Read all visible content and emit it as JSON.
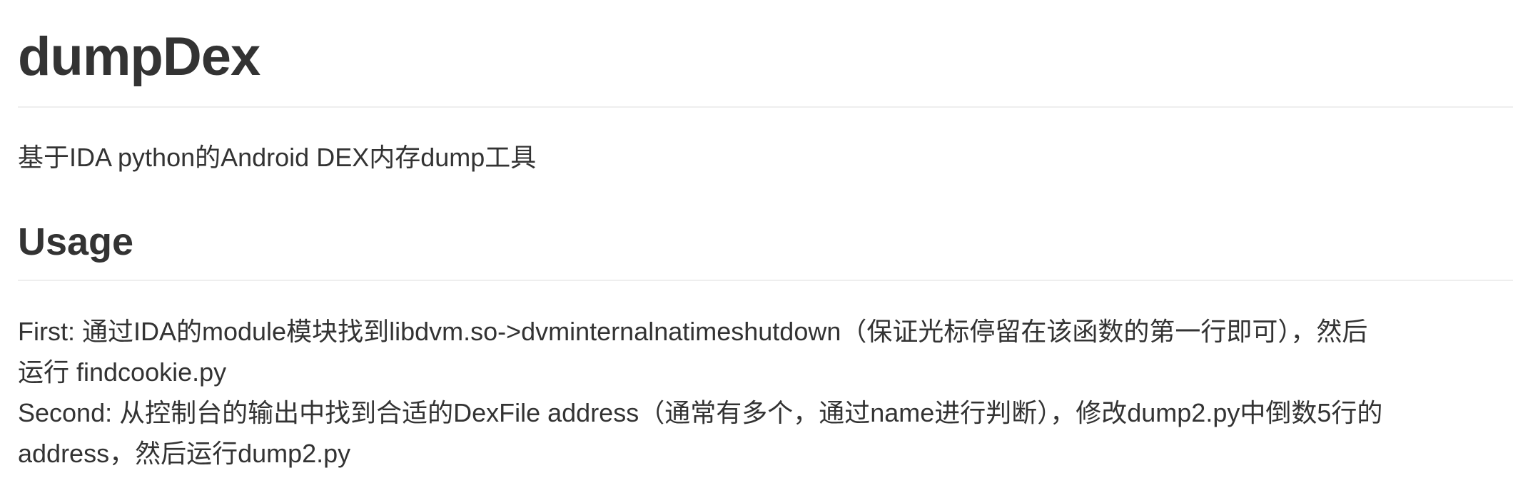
{
  "doc": {
    "title": "dumpDex",
    "intro": "基于IDA python的Android DEX内存dump工具",
    "usage_heading": "Usage",
    "usage_lines": [
      "First: 通过IDA的module模块找到libdvm.so->dvminternalnatimeshutdown（保证光标停留在该函数的第一行即可），然后",
      "运行 findcookie.py",
      "Second: 从控制台的输出中找到合适的DexFile address（通常有多个，通过name进行判断），修改dump2.py中倒数5行的",
      "address，然后运行dump2.py"
    ]
  }
}
